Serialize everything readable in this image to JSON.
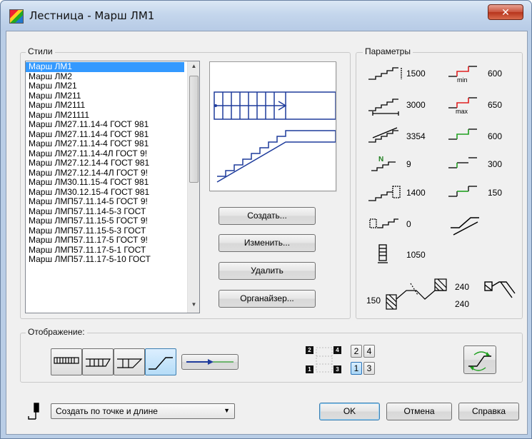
{
  "window": {
    "title": "Лестница - Марш ЛМ1",
    "close_label": "✕"
  },
  "styles": {
    "group_label": "Стили",
    "items": [
      "Марш ЛМ1",
      "Марш ЛМ2",
      "Марш ЛМ21",
      "Марш ЛМ211",
      "Марш ЛМ2111",
      "Марш ЛМ21111",
      "Марш ЛМ27.11.14-4 ГОСТ 981",
      "Марш ЛМ27.11.14-4 ГОСТ 981",
      "Марш ЛМ27.11.14-4 ГОСТ 981",
      "Марш ЛМ27.11.14-4Л ГОСТ 9!",
      "Марш ЛМ27.12.14-4 ГОСТ 981",
      "Марш ЛМ27.12.14-4Л ГОСТ 9!",
      "Марш ЛМ30.11.15-4 ГОСТ 981",
      "Марш ЛМ30.12.15-4 ГОСТ 981",
      "Марш ЛМП57.11.14-5 ГОСТ 9!",
      "Марш ЛМП57.11.14-5-3 ГОСТ",
      "Марш ЛМП57.11.15-5 ГОСТ 9!",
      "Марш ЛМП57.11.15-5-3 ГОСТ",
      "Марш ЛМП57.11.17-5 ГОСТ 9!",
      "Марш ЛМП57.11.17-5-1 ГОСТ",
      "Марш ЛМП57.11.17-5-10 ГОСТ"
    ],
    "selected_index": 0
  },
  "actions": {
    "create": "Создать...",
    "edit": "Изменить...",
    "delete": "Удалить",
    "organizer": "Органайзер..."
  },
  "params": {
    "group_label": "Параметры",
    "height": "1500",
    "length": "3000",
    "diagonal": "3354",
    "steps": "9",
    "width": "1400",
    "offset": "0",
    "thickness": "1050",
    "min_val": "600",
    "max_val": "650",
    "green1": "600",
    "riser": "300",
    "tread": "150",
    "bearing_left": "150",
    "bearing_top": "240",
    "bearing_bottom": "240",
    "min_sub": "min",
    "max_sub": "max",
    "steps_sub": "N"
  },
  "display": {
    "group_label": "Отображение:",
    "numbers": [
      "2",
      "4",
      "1",
      "3"
    ],
    "dark_numbers": [
      "2",
      "4",
      "1",
      "3"
    ],
    "active_number": "1"
  },
  "footer": {
    "mode_value": "Создать по точке и длине",
    "ok": "OK",
    "cancel": "Отмена",
    "help": "Справка"
  },
  "colors": {
    "selection": "#3399ff",
    "accent_red": "#e02020",
    "accent_green": "#20a020",
    "drawing_blue": "#1f3c9c"
  }
}
